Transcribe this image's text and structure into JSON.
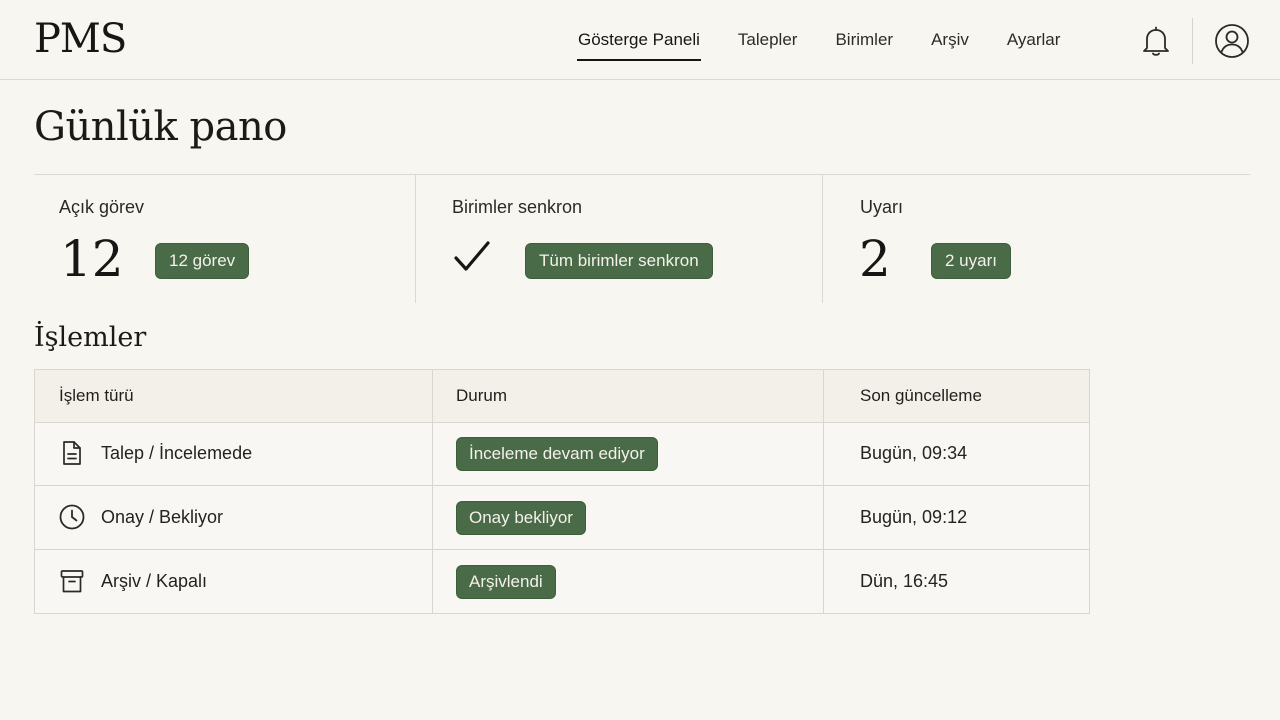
{
  "app": {
    "logo": "PMS"
  },
  "nav": {
    "items": [
      {
        "label": "Gösterge Paneli",
        "active": true
      },
      {
        "label": "Talepler",
        "active": false
      },
      {
        "label": "Birimler",
        "active": false
      },
      {
        "label": "Arşiv",
        "active": false
      },
      {
        "label": "Ayarlar",
        "active": false
      }
    ],
    "icons": {
      "notifications": "bell-icon",
      "profile": "user-circle-icon"
    }
  },
  "page": {
    "title": "Günlük pano"
  },
  "stats": {
    "open_tasks": {
      "label": "Açık görev",
      "value": "12",
      "badge": "12 görev"
    },
    "sync": {
      "label": "Birimler senkron",
      "icon": "checkmark-icon",
      "badge": "Tüm birimler senkron"
    },
    "alerts": {
      "label": "Uyarı",
      "value": "2",
      "badge": "2 uyarı"
    }
  },
  "operations": {
    "title": "İşlemler",
    "columns": [
      "İşlem türü",
      "Durum",
      "Son güncelleme"
    ],
    "rows": [
      {
        "icon": "document-icon",
        "type": "Talep / İncelemede",
        "status": "İnceleme devam ediyor",
        "updated": "Bugün, 09:34"
      },
      {
        "icon": "clock-icon",
        "type": "Onay / Bekliyor",
        "status": "Onay bekliyor",
        "updated": "Bugün, 09:12"
      },
      {
        "icon": "archive-box-icon",
        "type": "Arşiv / Kapalı",
        "status": "Arşivlendi",
        "updated": "Dün, 16:45"
      }
    ]
  },
  "colors": {
    "background": "#f8f6f1",
    "badge": "#4a6b47",
    "border": "#dcd9d2"
  }
}
